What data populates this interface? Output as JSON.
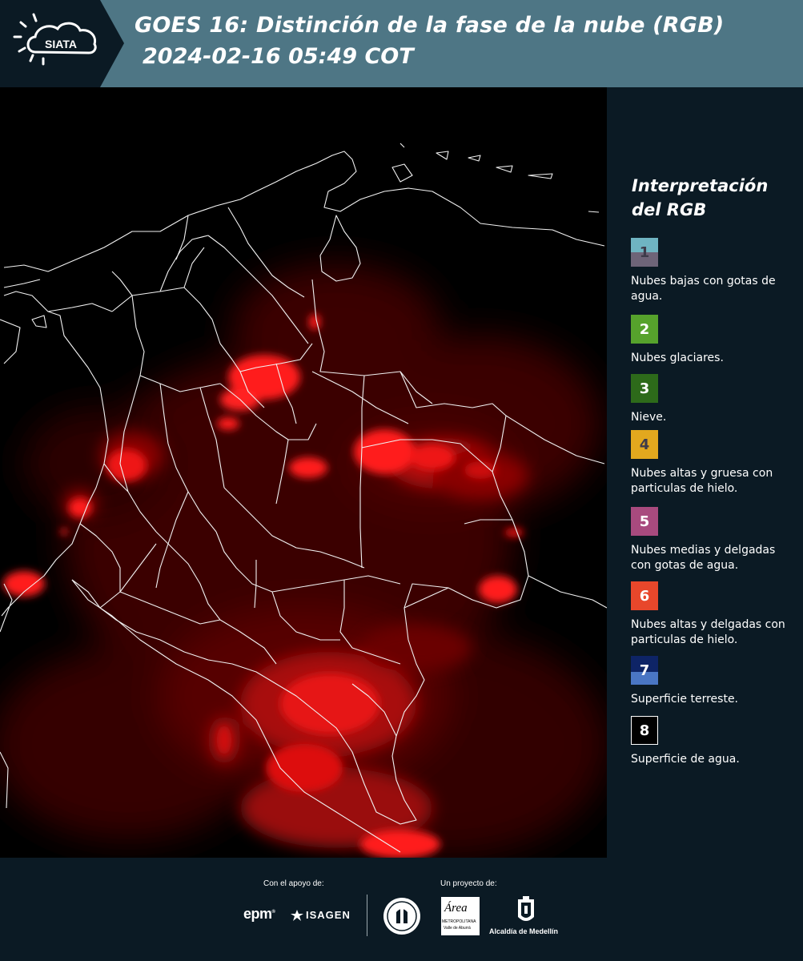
{
  "header": {
    "logo_text": "SIATA",
    "title_line1": "GOES 16: Distinción de la fase de la nube (RGB)",
    "title_line2": "2024-02-16 05:49 COT"
  },
  "legend": {
    "title": "Interpretación del RGB",
    "items": [
      {
        "number": "1",
        "label": "Nubes bajas con gotas de agua.",
        "color_top": "#6fb4c2",
        "color_bottom": "#6e6478",
        "num_color": "#3d3b4a"
      },
      {
        "number": "2",
        "label": "Nubes glaciares.",
        "color_top": "#56a22c",
        "color_bottom": "#56a22c",
        "num_color": "#ffffff"
      },
      {
        "number": "3",
        "label": "Nieve.",
        "color_top": "#2d6a1a",
        "color_bottom": "#2d6a1a",
        "num_color": "#ffffff"
      },
      {
        "number": "4",
        "label": "Nubes altas y gruesa con particulas de hielo.",
        "color_top": "#e2a81e",
        "color_bottom": "#e2a81e",
        "num_color": "#3d3b4a"
      },
      {
        "number": "5",
        "label": "Nubes medias y delgadas con gotas de agua.",
        "color_top": "#a84a7e",
        "color_bottom": "#a84a7e",
        "num_color": "#ffffff"
      },
      {
        "number": "6",
        "label": "Nubes altas y delgadas con particulas de hielo.",
        "color_top": "#e8472b",
        "color_bottom": "#e8472b",
        "num_color": "#ffffff"
      },
      {
        "number": "7",
        "label": "Superficie terreste.",
        "color_top": "#0e2466",
        "color_bottom": "#4a76c4",
        "num_color": "#ffffff"
      },
      {
        "number": "8",
        "label": "Superficie de agua.",
        "color_top": "#000000",
        "color_bottom": "#000000",
        "num_color": "#ffffff"
      }
    ]
  },
  "footer": {
    "support_label": "Con el apoyo de:",
    "project_label": "Un proyecto de:",
    "logos": {
      "epm": "epm",
      "isagen": "ISAGEN",
      "area_line1": "Área",
      "area_line2": "METROPOLITANA",
      "area_line3": "Valle de Aburrá",
      "alcaldia": "Alcaldía de Medellín"
    }
  },
  "colors": {
    "header_bg": "#4e7685",
    "header_dark": "#0b1a24",
    "panel_bg": "#0b1a24",
    "cloud_red": "#ff1a1a"
  }
}
